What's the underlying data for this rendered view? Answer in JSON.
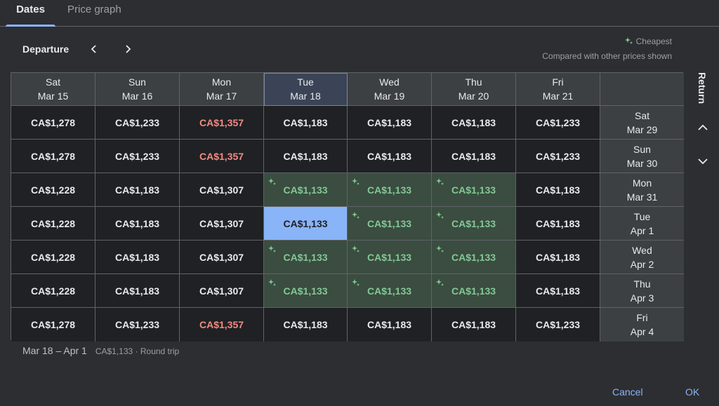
{
  "tabs": [
    {
      "label": "Dates",
      "active": true
    },
    {
      "label": "Price graph",
      "active": false
    }
  ],
  "departure": {
    "label": "Departure",
    "prev_icon": "chevron-left-icon",
    "next_icon": "chevron-right-icon"
  },
  "legend": {
    "cheapest_label": "Cheapest",
    "note": "Compared with other prices shown",
    "icon": "sparkle-icon"
  },
  "return_label": "Return",
  "columns": [
    {
      "day": "Sat",
      "date": "Mar 15"
    },
    {
      "day": "Sun",
      "date": "Mar 16"
    },
    {
      "day": "Mon",
      "date": "Mar 17"
    },
    {
      "day": "Tue",
      "date": "Mar 18"
    },
    {
      "day": "Wed",
      "date": "Mar 19"
    },
    {
      "day": "Thu",
      "date": "Mar 20"
    },
    {
      "day": "Fri",
      "date": "Mar 21"
    }
  ],
  "rows": [
    {
      "day": "Sat",
      "date": "Mar 29",
      "prices": [
        "CA$1,278",
        "CA$1,233",
        "CA$1,357",
        "CA$1,183",
        "CA$1,183",
        "CA$1,183",
        "CA$1,233"
      ]
    },
    {
      "day": "Sun",
      "date": "Mar 30",
      "prices": [
        "CA$1,278",
        "CA$1,233",
        "CA$1,357",
        "CA$1,183",
        "CA$1,183",
        "CA$1,183",
        "CA$1,233"
      ]
    },
    {
      "day": "Mon",
      "date": "Mar 31",
      "prices": [
        "CA$1,228",
        "CA$1,183",
        "CA$1,307",
        "CA$1,133",
        "CA$1,133",
        "CA$1,133",
        "CA$1,183"
      ]
    },
    {
      "day": "Tue",
      "date": "Apr 1",
      "prices": [
        "CA$1,228",
        "CA$1,183",
        "CA$1,307",
        "CA$1,133",
        "CA$1,133",
        "CA$1,133",
        "CA$1,183"
      ]
    },
    {
      "day": "Wed",
      "date": "Apr 2",
      "prices": [
        "CA$1,228",
        "CA$1,183",
        "CA$1,307",
        "CA$1,133",
        "CA$1,133",
        "CA$1,133",
        "CA$1,183"
      ]
    },
    {
      "day": "Thu",
      "date": "Apr 3",
      "prices": [
        "CA$1,228",
        "CA$1,183",
        "CA$1,307",
        "CA$1,133",
        "CA$1,133",
        "CA$1,133",
        "CA$1,183"
      ]
    },
    {
      "day": "Fri",
      "date": "Apr 4",
      "prices": [
        "CA$1,278",
        "CA$1,233",
        "CA$1,357",
        "CA$1,183",
        "CA$1,183",
        "CA$1,183",
        "CA$1,233"
      ]
    }
  ],
  "selection": {
    "dates": "Mar 18 – Apr 1",
    "price": "CA$1,133 · Round trip"
  },
  "buttons": {
    "cancel": "Cancel",
    "ok": "OK"
  },
  "colors": {
    "accent": "#8ab4f8",
    "cheapest": "#81c995",
    "expensive": "#f28b82",
    "cheap_bg": "#3b4c40"
  }
}
